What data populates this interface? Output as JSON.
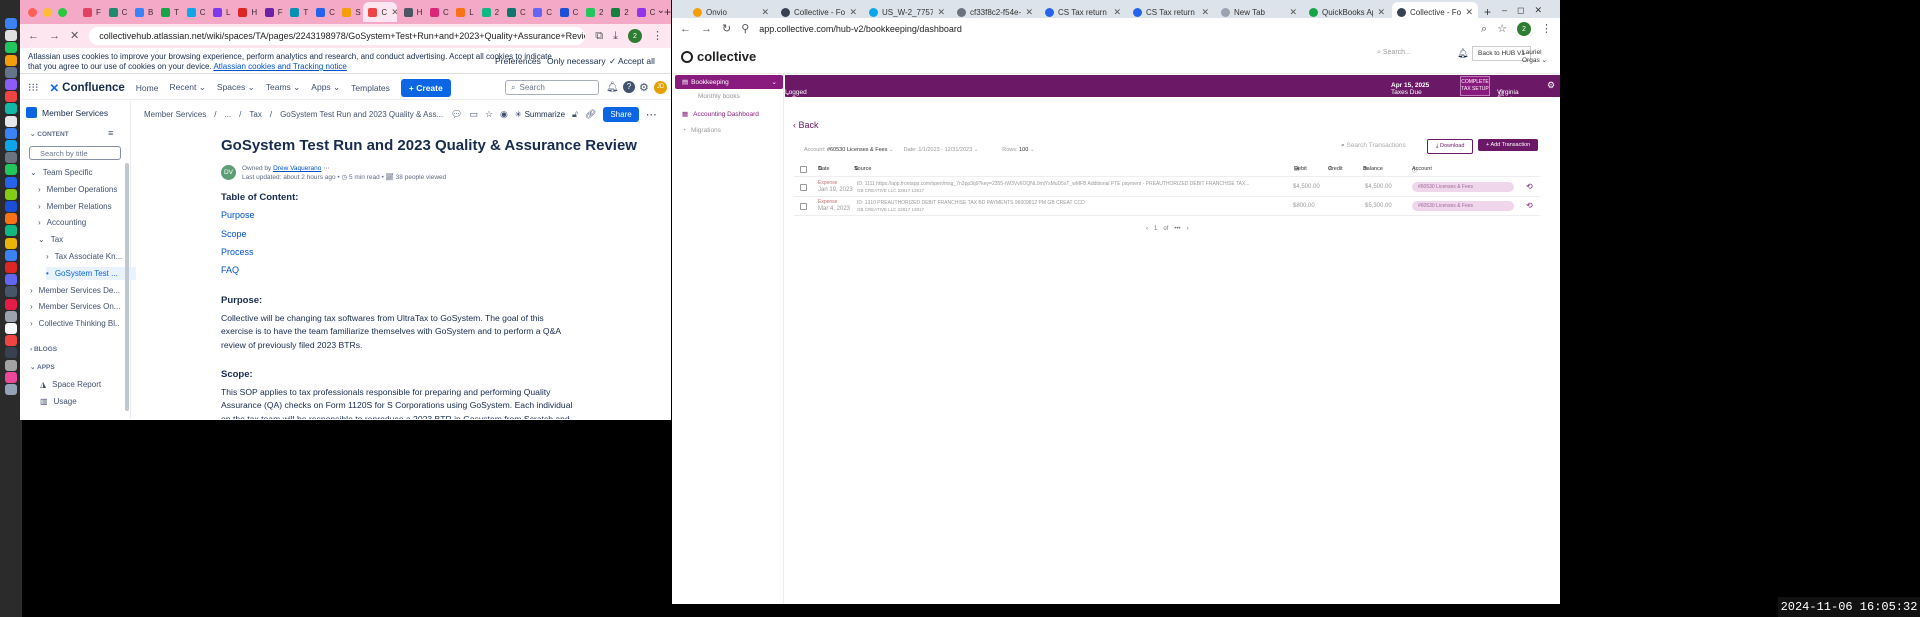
{
  "left_window": {
    "tab_count": 28,
    "tab_initials": [
      "F",
      "C",
      "B",
      "T",
      "C",
      "L",
      "H",
      "F",
      "T",
      "C",
      "S",
      "C",
      "H",
      "C",
      "L",
      "2",
      "C",
      "C",
      "C",
      "2",
      "2",
      "C"
    ],
    "url": "collectivehub.atlassian.net/wiki/spaces/TA/pages/2243198978/GoSystem+Test+Run+and+2023+Quality+Assurance+Review",
    "profile_letter": "2",
    "cookie": {
      "text_line1": "Atlassian uses cookies to improve your browsing experience, perform analytics and research, and conduct advertising. Accept all cookies to indicate",
      "text_line2": "that you agree to our use of cookies on your device.",
      "link": "Atlassian cookies and Tracking notice",
      "preferences": "Preferences",
      "only_necessary": "Only necessary",
      "accept_all": "Accept all"
    },
    "nav": {
      "logo": "Confluence",
      "home": "Home",
      "recent": "Recent",
      "spaces": "Spaces",
      "teams": "Teams",
      "apps": "Apps",
      "templates": "Templates",
      "create": "Create",
      "search_placeholder": "Search",
      "avatar": "JD"
    },
    "sidebar": {
      "space_name": "Member Services",
      "content_label": "CONTENT",
      "search_placeholder": "Search by title",
      "tree": [
        {
          "label": "Team Specific",
          "indent": 0,
          "arrow": "⌄"
        },
        {
          "label": "Member Operations",
          "indent": 1,
          "arrow": "›"
        },
        {
          "label": "Member Relations",
          "indent": 1,
          "arrow": "›"
        },
        {
          "label": "Accounting",
          "indent": 1,
          "arrow": "›"
        },
        {
          "label": "Tax",
          "indent": 1,
          "arrow": "⌄"
        },
        {
          "label": "Tax Associate Kn...",
          "indent": 2,
          "arrow": "›"
        },
        {
          "label": "GoSystem Test ...",
          "indent": 2,
          "arrow": "•",
          "selected": true
        },
        {
          "label": "Member Services De...",
          "indent": 0,
          "arrow": "›"
        },
        {
          "label": "Member Services On...",
          "indent": 0,
          "arrow": "›"
        },
        {
          "label": "Collective Thinking Bl...",
          "indent": 0,
          "arrow": "›"
        }
      ],
      "blogs_label": "BLOGS",
      "apps_label": "APPS",
      "space_report": "Space Report",
      "usage": "Usage"
    },
    "page": {
      "breadcrumbs": [
        "Member Services",
        "/",
        "...",
        "/",
        "Tax",
        "/",
        "GoSystem Test Run and 2023 Quality & Ass..."
      ],
      "summarize": "Summarize",
      "share": "Share",
      "title": "GoSystem Test Run and 2023 Quality & Assurance Review",
      "owned_by": "Owned by",
      "author": "Drew Vaquerano",
      "author_initials": "DV",
      "updated": "Last updated: about 2 hours ago",
      "read_time": "5 min read",
      "viewed": "38 people viewed",
      "toc_heading": "Table of Content:",
      "toc": [
        "Purpose",
        "Scope",
        "Process",
        "FAQ"
      ],
      "purpose_heading": "Purpose:",
      "purpose_text": "Collective will be changing tax softwares from UltraTax to GoSystem. The goal of this exercise is to have the team familiarize themselves with GoSystem and to perform a Q&A review of previously filed 2023 BTRs.",
      "scope_heading": "Scope:",
      "scope_text": "This SOP applies to tax professionals responsible for preparing and performing Quality Assurance (QA) checks on Form 1120S for S Corporations using GoSystem. Each individual on the tax team will be responsible to reproduce a 2023 BTR in Gosystem from Scratch and clear all diagnostics. After the"
    }
  },
  "right_window": {
    "tabs": [
      {
        "label": "Onvio"
      },
      {
        "label": "Collective - Focus on"
      },
      {
        "label": "US_W-2_7757616924"
      },
      {
        "label": "cf33f8c2-f54e-49f5-"
      },
      {
        "label": "CS Tax return for yea"
      },
      {
        "label": "CS Tax return for yea"
      },
      {
        "label": "New Tab"
      },
      {
        "label": "QuickBooks App Sto"
      },
      {
        "label": "Collective - Focus on",
        "active": true
      }
    ],
    "url": "app.collective.com/hub-v2/bookkeeping/dashboard",
    "profile_letter": "2",
    "app": {
      "logo": "collective",
      "search_placeholder": "Search...",
      "back_to_hub": "Back to HUB V1",
      "user": "Lauriel Orgas",
      "sidebar_header": "Bookkeeping",
      "sidebar_items": [
        "Monthly books",
        "Accounting Dashboard",
        "Migrations"
      ],
      "logged_in": "Logged In To: GB Creative LLC",
      "taxes_due_label": "Taxes Due",
      "taxes_due_date": "Apr 15, 2025",
      "complete_setup": "COMPLETE TAX SETUP",
      "advisor": "Virginia Boyd",
      "back": "Back",
      "filter_account_label": "Account:",
      "filter_account": "#60530 Licenses & Fees",
      "filter_date_label": "Date:",
      "filter_date": "1/1/2023 - 12/31/2023",
      "filter_rows_label": "Rows:",
      "filter_rows": "100",
      "txn_search_placeholder": "Search Transactions",
      "download": "Download",
      "add_transaction": "Add Transaction",
      "columns": {
        "date": "Date",
        "source": "Source",
        "debit": "Debit",
        "credit": "Credit",
        "balance": "Balance",
        "account": "Account"
      },
      "rows": [
        {
          "type": "Expense",
          "date": "Jan 19, 2023",
          "source": "ID: 1111 https://app.frontapp.com/open/msg_7n3pp3q9?key=2355-rW3Vv6OQNL0mjYsMuD5sT_wMFB Additional PTE payment - PREAUTHORIZED DEBIT FRANCHISE TAX...",
          "sub": "GB CREATIVE LLC 22817 12817",
          "debit": "$4,500.00",
          "credit": "",
          "balance": "$4,500.00",
          "account": "#60530 Licenses & Fees"
        },
        {
          "type": "Expense",
          "date": "Mar 4, 2023",
          "source": "ID: 1310 PREAUTHORIZED DEBIT FRANCHISE TAX BD PAYMENTS 96009812 PM GB CREAT CCD",
          "sub": "GB CREATIVE LLC 22817 12817",
          "debit": "$800.00",
          "credit": "",
          "balance": "$5,300.00",
          "account": "#60530 Licenses & Fees"
        }
      ],
      "page_current": "1",
      "page_of": "of",
      "page_more": "•••"
    }
  },
  "clock": "2024-11-06 16:05:32"
}
